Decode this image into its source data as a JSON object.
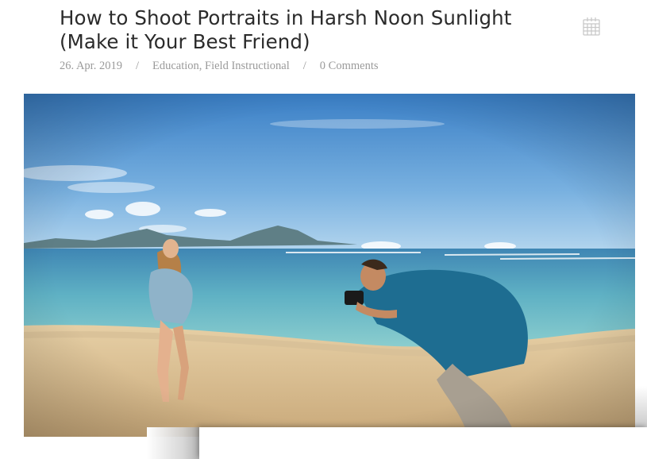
{
  "post": {
    "title": "How to Shoot Portraits in Harsh Noon Sunlight (Make it Your Best Friend)",
    "date": "26. Apr. 2019",
    "separator": "/",
    "categories": [
      "Education",
      "Field Instructional"
    ],
    "category_separator": ",",
    "comments": "0 Comments"
  },
  "icons": {
    "calendar": "calendar-icon"
  },
  "colors": {
    "title": "#2b2b2b",
    "meta": "#9a9a9a",
    "icon": "#c8c8c8"
  }
}
